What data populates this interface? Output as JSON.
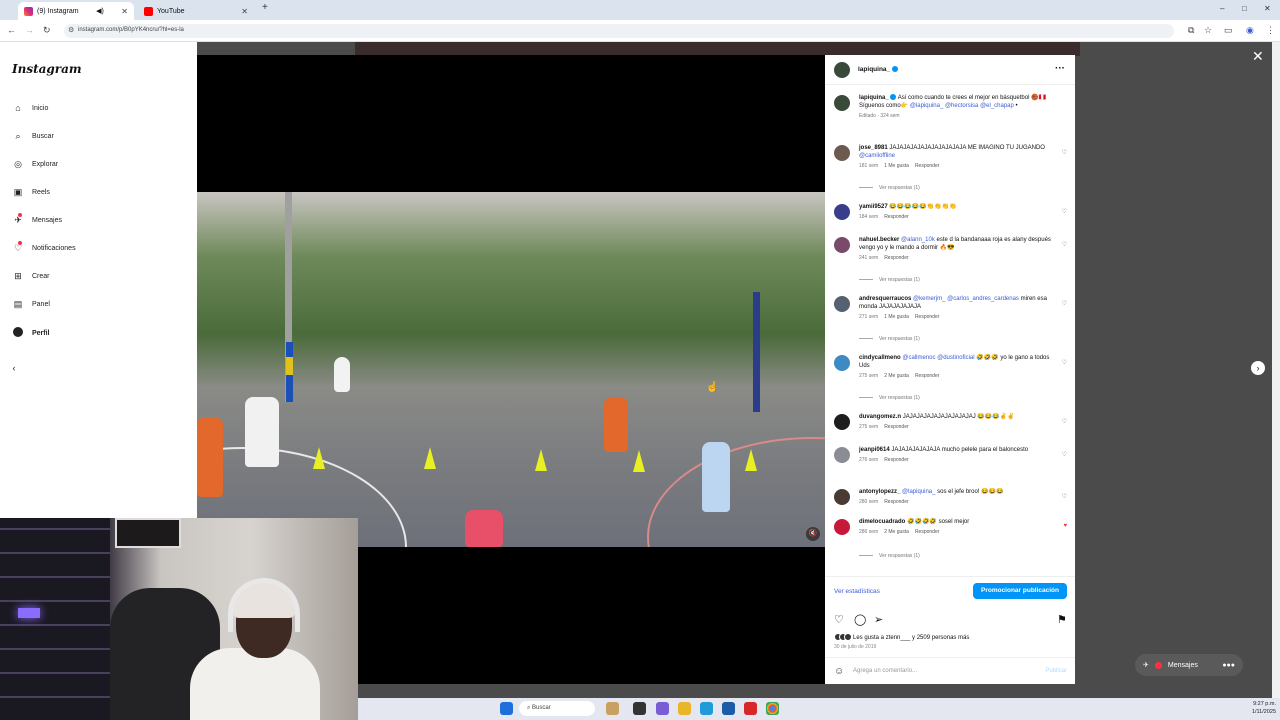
{
  "browser": {
    "tabs": [
      {
        "label": "(9) Instagram",
        "active": true
      },
      {
        "label": "YouTube",
        "active": false
      }
    ],
    "new_tab": "+",
    "url": "instagram.com/p/B0pYK4ncru/?hl=es-la",
    "window_controls": [
      "–",
      "□",
      "✕"
    ]
  },
  "sidebar": {
    "logo": "Instagram",
    "items": [
      {
        "label": "Inicio",
        "icon": "home-icon"
      },
      {
        "label": "Buscar",
        "icon": "search-icon"
      },
      {
        "label": "Explorar",
        "icon": "explore-icon"
      },
      {
        "label": "Reels",
        "icon": "reels-icon"
      },
      {
        "label": "Mensajes",
        "icon": "messages-icon"
      },
      {
        "label": "Notificaciones",
        "icon": "heart-icon"
      },
      {
        "label": "Crear",
        "icon": "plus-icon"
      },
      {
        "label": "Panel",
        "icon": "chart-icon"
      },
      {
        "label": "Perfil",
        "icon": "avatar"
      }
    ]
  },
  "post": {
    "author": "lapiquina_",
    "caption_user": "lapiquina_",
    "caption_text": "Así como cuando te crees el mejor en básquetbol 🏀🇵🇪",
    "caption_line2_prefix": "Síguenos como👉",
    "caption_mentions": "@lapiquina_ @hectorsisa @el_chapap",
    "caption_suffix": "•",
    "caption_meta": "Editado · 324 sem",
    "comments": [
      {
        "user": "jose_8981",
        "text": "JAJAJAJAJAJAJAJAJAJAJA ME IMAGINO TU JUGANDO ",
        "mention": "@camiloffline",
        "meta": [
          "181 sem",
          "1 Me gusta",
          "Responder"
        ],
        "replies": "Ver respuestas (1)"
      },
      {
        "user": "yamii9527",
        "text": "😂😂😂😂😂👏👏👏👏",
        "mention": "",
        "meta": [
          "184 sem",
          "Responder"
        ],
        "replies": ""
      },
      {
        "user": "nahuel.becker",
        "text": " este d la bandanaaa roja es alany después vengo yo y le mando a dormir 🔥😎",
        "mention": "@alann_10k",
        "meta": [
          "241 sem",
          "Responder"
        ],
        "replies": "Ver respuestas (1)"
      },
      {
        "user": "andresquerraucos",
        "text": " miren esa monda JAJAJAJAJAJA",
        "mention": "@kemerjm_ @carlos_andres_cardenas",
        "meta": [
          "271 sem",
          "1 Me gusta",
          "Responder"
        ],
        "replies": "Ver respuestas (1)"
      },
      {
        "user": "cindycallmeno",
        "text": " 🤣🤣🤣 yo le gano a todos Uds",
        "mention": "@callmenoc @dustinoficial",
        "meta": [
          "275 sem",
          "2 Me gusta",
          "Responder"
        ],
        "replies": "Ver respuestas (1)"
      },
      {
        "user": "duvangomez.n",
        "text": "JAJAJAJAJAJAJAJAJAJAJ 😂😂😂✌️✌️",
        "mention": "",
        "meta": [
          "275 sem",
          "Responder"
        ],
        "replies": ""
      },
      {
        "user": "jeanpi0614",
        "text": "JAJAJAJAJAJAJA mucho pelele para el baloncesto",
        "mention": "",
        "meta": [
          "276 sem",
          "Responder"
        ],
        "replies": ""
      },
      {
        "user": "antonylopezz_",
        "text": " sos el jefe broo! 😂😂😂",
        "mention": "@lapiquina_",
        "meta": [
          "280 sem",
          "Responder"
        ],
        "replies": ""
      },
      {
        "user": "dimelocuadrado",
        "text": "🤣🤣🤣🤣 sosel mejor",
        "mention": "",
        "meta": [
          "286 sem",
          "2 Me gusta",
          "Responder"
        ],
        "replies": "Ver respuestas (1)"
      }
    ],
    "stats_link": "Ver estadísticas",
    "promote_button": "Promocionar publicación",
    "likes_text": "Les gusta a ztenn___ y 2509 personas más",
    "date": "30 de julio de 2019",
    "add_comment_placeholder": "Agrega un comentario...",
    "publish": "Publicar"
  },
  "messages_pill": "Mensajes",
  "taskbar": {
    "search": "Buscar",
    "time": "9:27 p.m.",
    "date": "1/11/2025"
  },
  "colors": {
    "accent": "#0095f6",
    "link": "#3b5bd6",
    "notification": "#ff3040"
  }
}
